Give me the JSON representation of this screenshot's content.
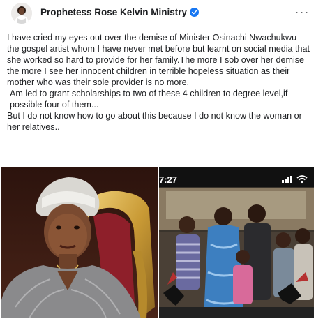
{
  "post": {
    "author": "Prophetess Rose Kelvin Ministry",
    "paragraphs": [
      "I have cried my eyes out over the demise of Minister Osinachi Nwachukwu the gospel artist whom I have never met before but learnt on social media that she worked so hard to provide for her family.The more I sob over her demise the more I see her innocent children in terrible hopeless situation as their mother who was their sole provider is no more.",
      "Am led to grant scholarships to two of these 4 children to degree level,if possible four of them...",
      "But I do not know how to go about this because I do not know the woman or her relatives.."
    ]
  },
  "photos": {
    "right_status_time": "7:27"
  },
  "colors": {
    "verified_blue": "#1877f2",
    "text": "#1c1e21",
    "muted": "#65676b"
  },
  "icons": {
    "more": "more-options-icon",
    "verified": "verified-badge-icon"
  }
}
